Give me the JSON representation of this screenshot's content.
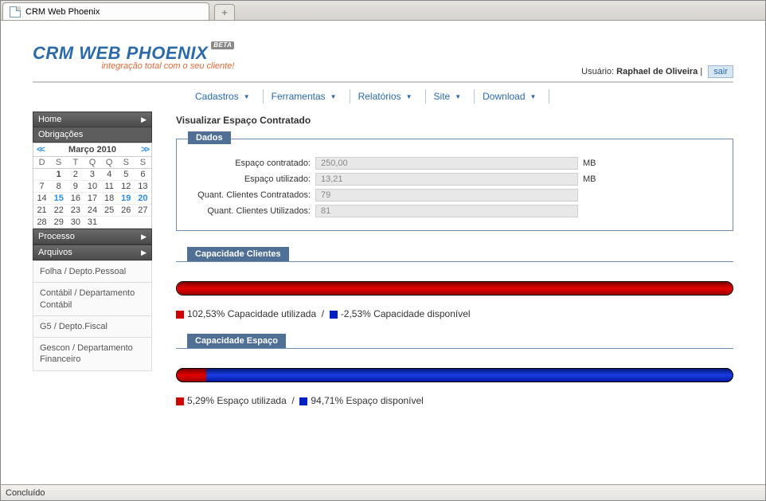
{
  "browser": {
    "tab_title": "CRM Web Phoenix",
    "status": "Concluído"
  },
  "logo": {
    "line1": "CRM WEB PHOENIX",
    "beta": "BETA",
    "line2": "integração total com o seu cliente!"
  },
  "user": {
    "label": "Usuário:",
    "name": "Raphael de Oliveira",
    "logout": "sair"
  },
  "topmenu": {
    "items": [
      "Cadastros",
      "Ferramentas",
      "Relatórios",
      "Site",
      "Download"
    ]
  },
  "sidebar": {
    "home": "Home",
    "obrigacoes": "Obrigações",
    "processo": "Processo",
    "arquivos": "Arquivos",
    "sub_items": [
      "Folha / Depto.Pessoal",
      "Contábil / Departamento Contábil",
      "G5 / Depto.Fiscal",
      "Gescon / Departamento Financeiro"
    ]
  },
  "calendar": {
    "title": "Março 2010",
    "dow": [
      "D",
      "S",
      "T",
      "Q",
      "Q",
      "S",
      "S"
    ],
    "weeks": [
      [
        "",
        "1",
        "2",
        "3",
        "4",
        "5",
        "6"
      ],
      [
        "7",
        "8",
        "9",
        "10",
        "11",
        "12",
        "13"
      ],
      [
        "14",
        "15",
        "16",
        "17",
        "18",
        "19",
        "20"
      ],
      [
        "21",
        "22",
        "23",
        "24",
        "25",
        "26",
        "27"
      ],
      [
        "28",
        "29",
        "30",
        "31",
        "",
        "",
        ""
      ]
    ],
    "highlight": [
      "15",
      "19",
      "20"
    ],
    "bold": [
      "1"
    ]
  },
  "page": {
    "title": "Visualizar Espaço Contratado"
  },
  "dados": {
    "legend": "Dados",
    "rows": [
      {
        "label": "Espaço contratado:",
        "value": "250,00",
        "unit": "MB"
      },
      {
        "label": "Espaço utilizado:",
        "value": "13,21",
        "unit": "MB"
      },
      {
        "label": "Quant. Clientes Contratados:",
        "value": "79",
        "unit": ""
      },
      {
        "label": "Quant. Clientes Utilizados:",
        "value": "81",
        "unit": ""
      }
    ]
  },
  "cap_clientes": {
    "heading": "Capacidade Clientes",
    "used_pct": 102.53,
    "avail_pct": -2.53,
    "used_label": "102,53% Capacidade utilizada",
    "avail_label": "-2,53% Capacidade disponível"
  },
  "cap_espaco": {
    "heading": "Capacidade Espaço",
    "used_pct": 5.29,
    "avail_pct": 94.71,
    "used_label": "5,29% Espaço utilizada",
    "avail_label": "94,71% Espaço disponível"
  },
  "chart_data": [
    {
      "type": "bar",
      "title": "Capacidade Clientes",
      "orientation": "horizontal-stacked",
      "categories": [
        ""
      ],
      "series": [
        {
          "name": "Capacidade utilizada",
          "values": [
            102.53
          ],
          "color": "#d00000"
        },
        {
          "name": "Capacidade disponível",
          "values": [
            -2.53
          ],
          "color": "#0020c0"
        }
      ],
      "xlim": [
        0,
        100
      ],
      "unit": "%"
    },
    {
      "type": "bar",
      "title": "Capacidade Espaço",
      "orientation": "horizontal-stacked",
      "categories": [
        ""
      ],
      "series": [
        {
          "name": "Espaço utilizada",
          "values": [
            5.29
          ],
          "color": "#d00000"
        },
        {
          "name": "Espaço disponível",
          "values": [
            94.71
          ],
          "color": "#0020c0"
        }
      ],
      "xlim": [
        0,
        100
      ],
      "unit": "%"
    }
  ]
}
